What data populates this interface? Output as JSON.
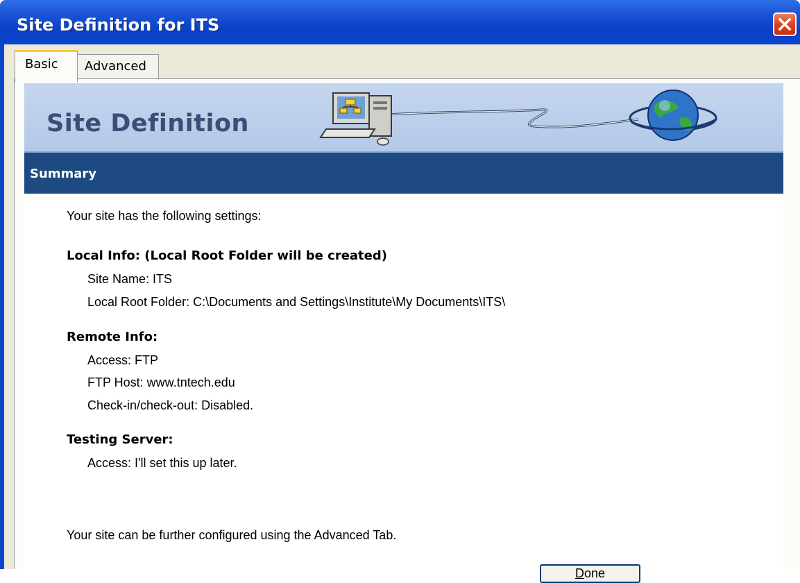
{
  "window": {
    "title": "Site Definition for ITS",
    "close_icon": "close-icon"
  },
  "tabs": [
    {
      "label": "Basic",
      "selected": true
    },
    {
      "label": "Advanced",
      "selected": false
    }
  ],
  "banner": {
    "title": "Site Definition",
    "art_icons": [
      "computer-icon",
      "globe-icon"
    ]
  },
  "summary": {
    "header": "Summary",
    "intro": "Your site has the following settings:",
    "sections": [
      {
        "heading": "Local Info: (Local Root Folder will be created)",
        "lines": [
          "Site Name: ITS",
          "Local Root Folder: C:\\Documents and Settings\\Institute\\My Documents\\ITS\\"
        ]
      },
      {
        "heading": "Remote Info:",
        "lines": [
          "Access: FTP",
          "FTP Host: www.tntech.edu",
          "Check-in/check-out: Disabled."
        ]
      },
      {
        "heading": "Testing Server:",
        "lines": [
          "Access: I'll set this up later."
        ]
      }
    ],
    "footer_note": "Your site can be further configured using the Advanced Tab."
  },
  "buttons": {
    "done_mnemonic": "D",
    "done_rest": "one"
  },
  "colors": {
    "titlebar": "#0b46cf",
    "banner": "#b4c9e8",
    "summary_bar": "#1d4a80",
    "close_button": "#d9401d"
  }
}
